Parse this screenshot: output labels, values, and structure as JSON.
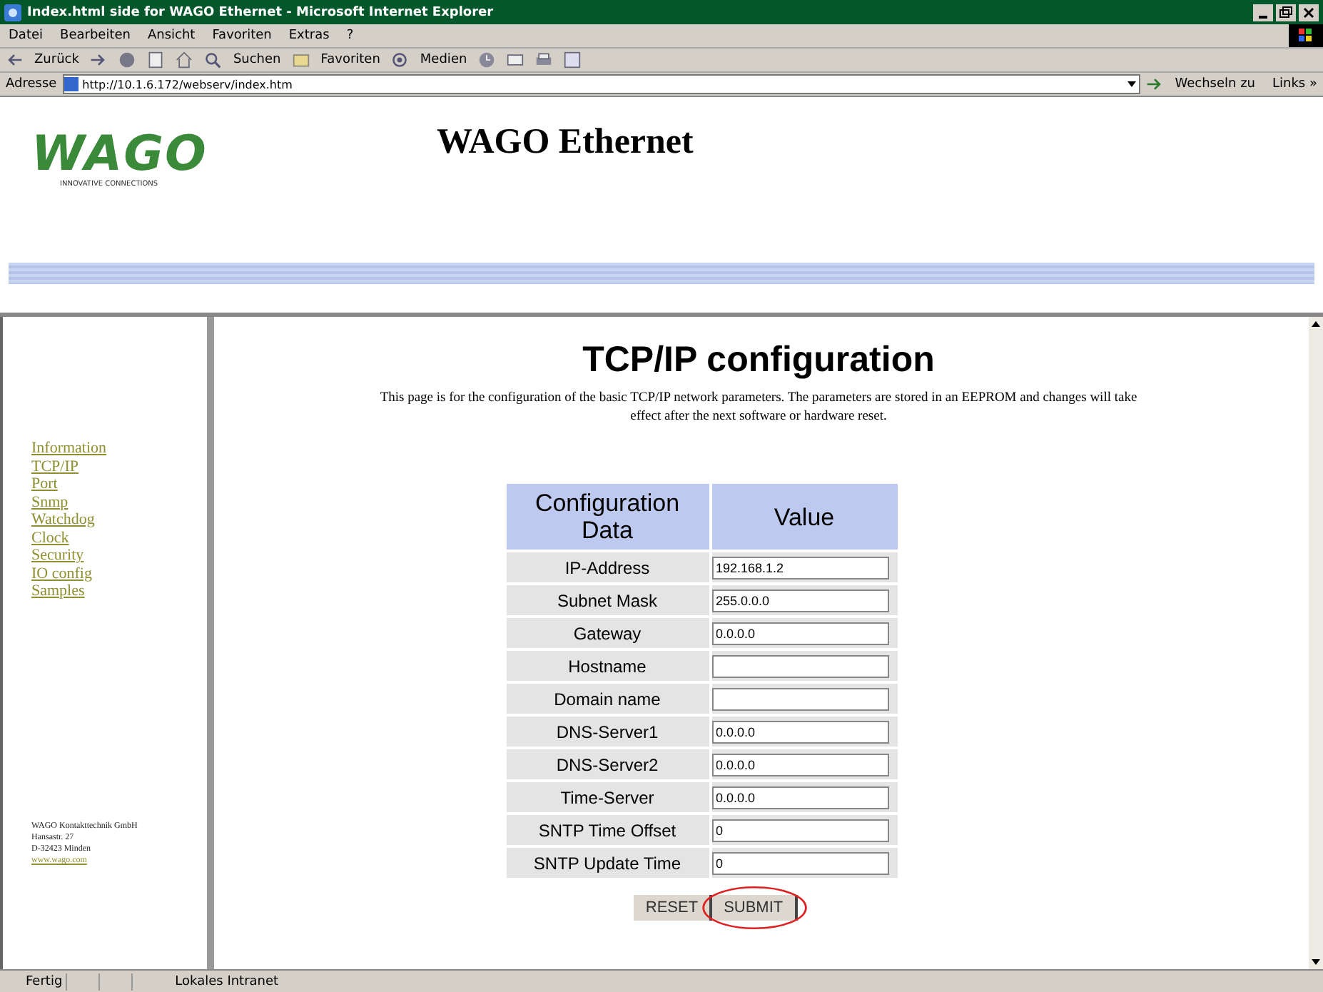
{
  "window": {
    "title": "Index.html side for WAGO Ethernet - Microsoft Internet Explorer"
  },
  "menu": [
    "Datei",
    "Bearbeiten",
    "Ansicht",
    "Favoriten",
    "Extras",
    "?"
  ],
  "toolbar": {
    "back": "Zurück",
    "search": "Suchen",
    "favorites": "Favoriten",
    "media": "Medien"
  },
  "address_bar": {
    "label": "Adresse",
    "value": "http://10.1.6.172/webserv/index.htm",
    "go": "Wechseln zu",
    "links": "Links »"
  },
  "header": {
    "logo": "WAGO",
    "logo_tagline": "INNOVATIVE CONNECTIONS",
    "title": "WAGO Ethernet"
  },
  "sidebar": {
    "items": [
      "Information",
      "TCP/IP",
      "Port",
      "Snmp",
      "Watchdog",
      "Clock",
      "Security",
      "IO config",
      "Samples"
    ],
    "footer": [
      "WAGO Kontakttechnik GmbH",
      "Hansastr. 27",
      "D-32423 Minden"
    ],
    "footer_link": "www.wago.com"
  },
  "main": {
    "heading": "TCP/IP configuration",
    "intro": "This page is for the configuration of the basic TCP/IP network parameters. The parameters are stored in an EEPROM and changes will take effect after the next software or hardware reset.",
    "table": {
      "columns": [
        "Configuration Data",
        "Value"
      ],
      "rows": [
        {
          "label": "IP-Address",
          "value": "192.168.1.2"
        },
        {
          "label": "Subnet Mask",
          "value": "255.0.0.0"
        },
        {
          "label": "Gateway",
          "value": "0.0.0.0"
        },
        {
          "label": "Hostname",
          "value": ""
        },
        {
          "label": "Domain name",
          "value": ""
        },
        {
          "label": "DNS-Server1",
          "value": "0.0.0.0"
        },
        {
          "label": "DNS-Server2",
          "value": "0.0.0.0"
        },
        {
          "label": "Time-Server",
          "value": "0.0.0.0"
        },
        {
          "label": "SNTP Time Offset",
          "value": "0"
        },
        {
          "label": "SNTP Update Time",
          "value": "0"
        }
      ]
    },
    "buttons": [
      {
        "label": "RESET",
        "highlighted": false
      },
      {
        "label": "SUBMIT",
        "highlighted": true
      }
    ]
  },
  "status_bar": {
    "text": "Fertig",
    "zone": "Lokales Intranet"
  }
}
